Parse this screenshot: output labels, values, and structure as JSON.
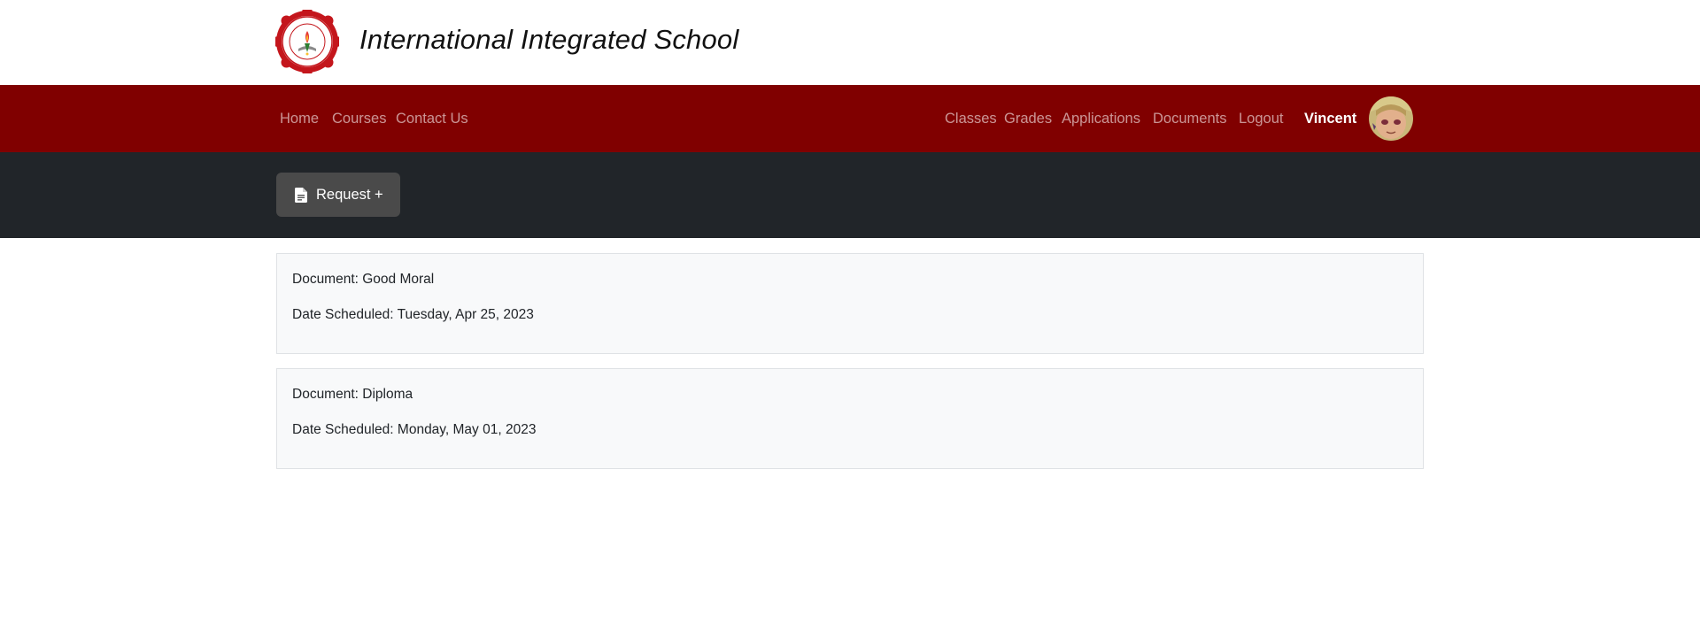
{
  "header": {
    "school_name": "International Integrated School",
    "logo_icon": "school-seal-logo"
  },
  "navbar": {
    "left_links": [
      {
        "label": "Home"
      },
      {
        "label": "Courses"
      },
      {
        "label": "Contact Us"
      }
    ],
    "right_links": [
      {
        "label": "Classes"
      },
      {
        "label": "Grades"
      },
      {
        "label": "Applications"
      },
      {
        "label": "Documents"
      },
      {
        "label": "Logout"
      }
    ],
    "user_name": "Vincent",
    "avatar_icon": "user-avatar",
    "background_color": "#800000"
  },
  "actions": {
    "request_label": "Request +",
    "request_icon": "document-icon"
  },
  "documents": [
    {
      "document_line": "Document: Good Moral",
      "date_line": "Date Scheduled: Tuesday, Apr 25, 2023"
    },
    {
      "document_line": "Document: Diploma",
      "date_line": "Date Scheduled: Monday, May 01, 2023"
    }
  ]
}
